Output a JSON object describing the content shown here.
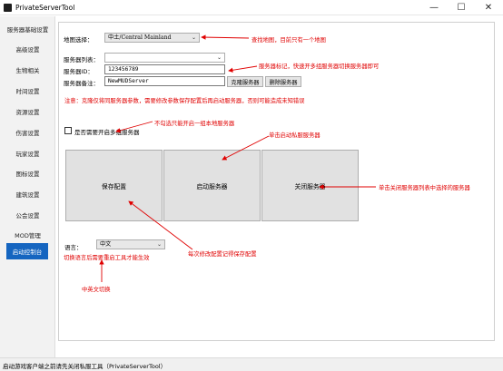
{
  "window": {
    "title": "PrivateServerTool",
    "minimize_glyph": "—",
    "maximize_glyph": "☐",
    "close_glyph": "✕"
  },
  "sidebar": {
    "items": [
      {
        "label": "服务器基础设置"
      },
      {
        "label": "高级设置"
      },
      {
        "label": "生物相关"
      },
      {
        "label": "时间设置"
      },
      {
        "label": "资源设置"
      },
      {
        "label": "伤害设置"
      },
      {
        "label": "玩家设置"
      },
      {
        "label": "图标设置"
      },
      {
        "label": "建筑设置"
      },
      {
        "label": "公会设置"
      },
      {
        "label": "MOD管理"
      },
      {
        "label": "启动控制台"
      }
    ],
    "active_index": 11
  },
  "form": {
    "map_label": "地图选择：",
    "map_value": "中土/Central Mainland",
    "server_list_label": "服务器列表：",
    "server_list_value": "",
    "server_id_label": "服务器ID：",
    "server_id_value": "123456789",
    "server_note_label": "服务器备注：",
    "server_note_value": "NewMUDServer",
    "clone_button": "克隆服务器",
    "delete_button": "删除服务器",
    "warning": "注意：克隆仅将同服务器参数，需要修改参数保存配置后再启动服务器，否则可能造成未知错误",
    "checkbox_label": "是否需要开启多组服务器",
    "checkbox_checked": false,
    "save_button": "保存配置",
    "start_button": "启动服务器",
    "stop_button": "关闭服务器",
    "language_label": "语言：",
    "language_value": "中文",
    "language_note": "切换语言后需要重启工具才能生效"
  },
  "annotations": {
    "map": "查找地图，目前只有一个地图",
    "server_marker": "服务器标记，快速开多组服务器切换服务器即可",
    "checkbox": "不勾选只能开启一组本地服务器",
    "start": "单击启动私服服务器",
    "stop": "单击关闭服务器列表中选择的服务器",
    "save": "每次修改配置记得保存配置",
    "language": "中英文切换"
  },
  "status": {
    "text": "启动游戏客户端之前请先关闭私服工具（PrivateServerTool）"
  },
  "colors": {
    "accent": "#1565c0",
    "annotation": "#e00000"
  }
}
